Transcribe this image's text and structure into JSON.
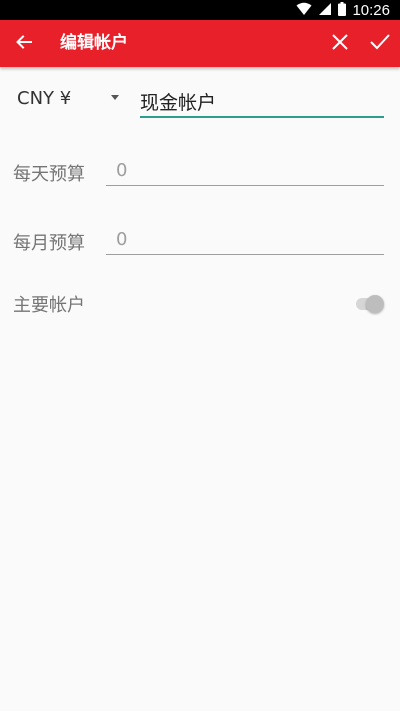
{
  "status_bar": {
    "time": "10:26",
    "wifi_icon": "wifi-icon",
    "signal_icon": "signal-icon",
    "battery_icon": "battery-icon"
  },
  "toolbar": {
    "title": "编辑帐户",
    "back_icon": "arrow-left-icon",
    "close_icon": "close-icon",
    "done_icon": "check-icon",
    "background_color": "#e8202a"
  },
  "form": {
    "currency": "CNY ¥",
    "account_name": "现金帐户",
    "daily_budget_label": "每天预算",
    "daily_budget_placeholder": "0",
    "monthly_budget_label": "每月预算",
    "monthly_budget_placeholder": "0",
    "primary_account_label": "主要帐户",
    "primary_account_enabled": false
  }
}
